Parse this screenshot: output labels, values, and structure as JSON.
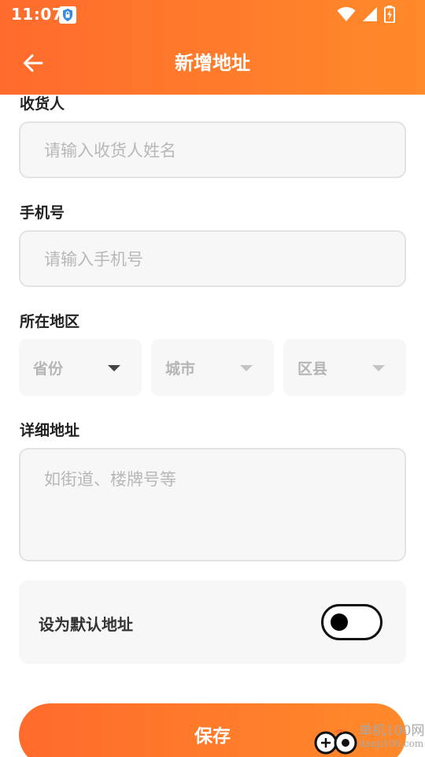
{
  "status_bar": {
    "time": "11:07",
    "icons": [
      "shield-notification-icon",
      "wifi-icon",
      "signal-icon",
      "battery-charging-icon"
    ]
  },
  "header": {
    "back_icon": "arrow-left-icon",
    "title": "新增地址"
  },
  "form": {
    "receiver": {
      "label": "收货人",
      "placeholder": "请输入收货人姓名"
    },
    "phone": {
      "label": "手机号",
      "placeholder": "请输入手机号"
    },
    "region": {
      "label": "所在地区",
      "selects": [
        {
          "placeholder": "省份",
          "icon": "caret-down-icon"
        },
        {
          "placeholder": "城市",
          "icon": "caret-down-icon"
        },
        {
          "placeholder": "区县",
          "icon": "caret-down-icon"
        }
      ]
    },
    "detail": {
      "label": "详细地址",
      "placeholder": "如街道、楼牌号等"
    },
    "default_address": {
      "label": "设为默认地址",
      "enabled": false
    }
  },
  "actions": {
    "save_label": "保存"
  },
  "watermark": {
    "line1": "单机100网",
    "line2": "danji100.com"
  },
  "colors": {
    "accent_start": "#ff6b2c",
    "accent_end": "#ff8a2a",
    "input_bg": "#f7f7f7",
    "placeholder": "#b8b8b8"
  }
}
